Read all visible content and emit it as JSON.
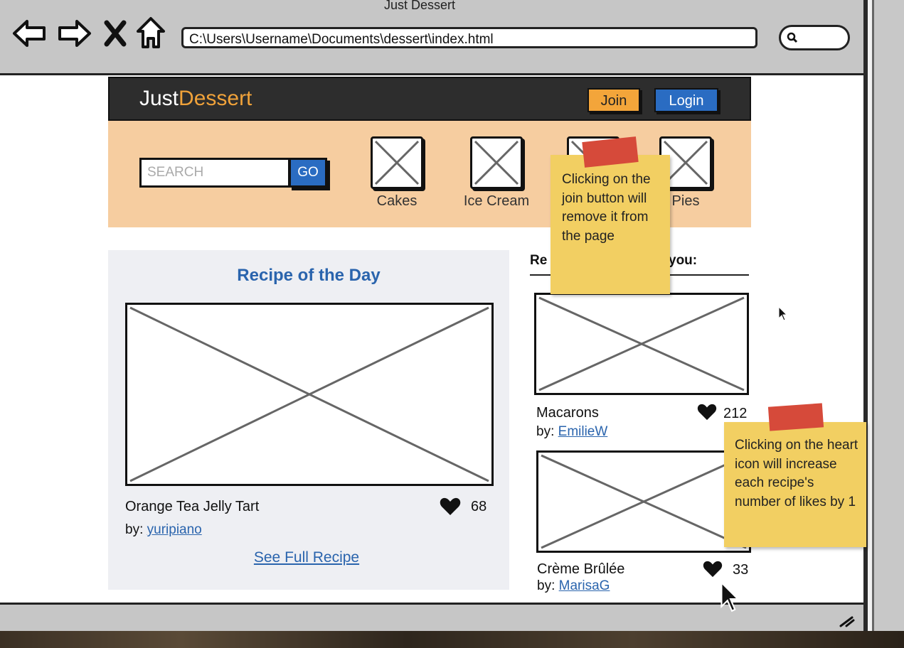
{
  "window": {
    "title": "Just Dessert"
  },
  "toolbar": {
    "address": "C:\\Users\\Username\\Documents\\dessert\\index.html",
    "icons": [
      "back-arrow-icon",
      "forward-arrow-icon",
      "close-x-icon",
      "home-icon",
      "search-icon"
    ]
  },
  "site": {
    "logo_part1": "Just",
    "logo_part2": "Dessert",
    "join_label": "Join",
    "login_label": "Login",
    "search_placeholder": "SEARCH",
    "go_label": "GO",
    "categories": [
      {
        "label": "Cakes"
      },
      {
        "label": "Ice Cream"
      },
      {
        "label": ""
      },
      {
        "label": "Pies"
      }
    ]
  },
  "recipe_of_day": {
    "title": "Recipe of the Day",
    "name": "Orange Tea Jelly Tart",
    "by_prefix": "by:",
    "author": "yuripiano",
    "likes": "68",
    "see_full_label": "See Full Recipe"
  },
  "recommendations": {
    "heading_left": "Re",
    "heading_right": "you:",
    "items": [
      {
        "name": "Macarons",
        "by_prefix": "by:",
        "author": "EmilieW",
        "likes": "212"
      },
      {
        "name": "Crème Brûlée",
        "by_prefix": "by:",
        "author": "MarisaG",
        "likes": "33"
      }
    ]
  },
  "notes": {
    "join_note": "Clicking on the join button will remove it from the page",
    "heart_note": "Clicking on the heart icon will increase each recipe's number of likes by 1"
  },
  "colors": {
    "header_bg": "#2d2d2d",
    "accent_orange": "#f3a53a",
    "accent_blue": "#2a6cc2",
    "banner_bg": "#f6cda0",
    "sticky": "#f2cf62",
    "tape": "#d64a3a"
  }
}
